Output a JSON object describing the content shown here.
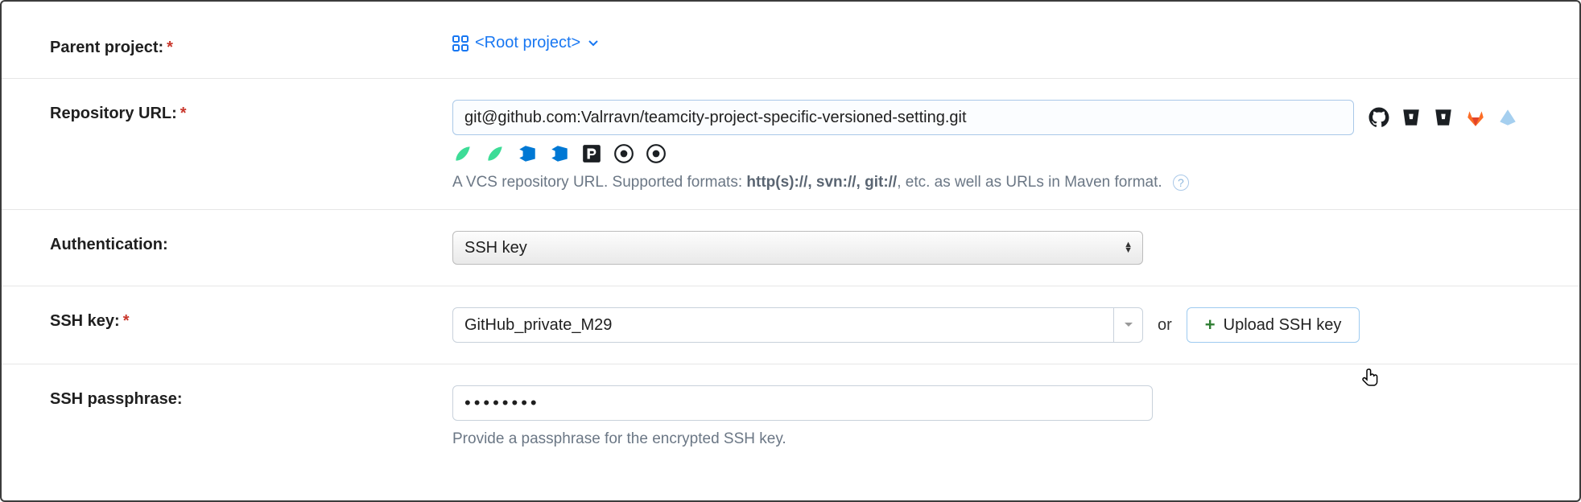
{
  "parent": {
    "label": "Parent project:",
    "required": true,
    "value": "<Root project>"
  },
  "repository": {
    "label": "Repository URL:",
    "required": true,
    "value": "git@github.com:Valrravn/teamcity-project-specific-versioned-setting.git",
    "helper_prefix": "A VCS repository URL. Supported formats: ",
    "helper_formats": "http(s)://, svn://, git://",
    "helper_suffix": ", etc. as well as URLs in Maven format.",
    "icons": [
      "github",
      "bitbucket",
      "bitbucket-dark",
      "gitlab",
      "azure",
      "space-green",
      "space-blue",
      "jetbrains-1",
      "jetbrains-2",
      "perforce",
      "github-outline",
      "github-outline-2"
    ]
  },
  "auth": {
    "label": "Authentication:",
    "value": "SSH key"
  },
  "sshkey": {
    "label": "SSH key:",
    "required": true,
    "value": "GitHub_private_M29",
    "or": "or",
    "upload_label": "Upload SSH key"
  },
  "passphrase": {
    "label": "SSH passphrase:",
    "value_masked": "••••••••",
    "helper": "Provide a passphrase for the encrypted SSH key."
  }
}
